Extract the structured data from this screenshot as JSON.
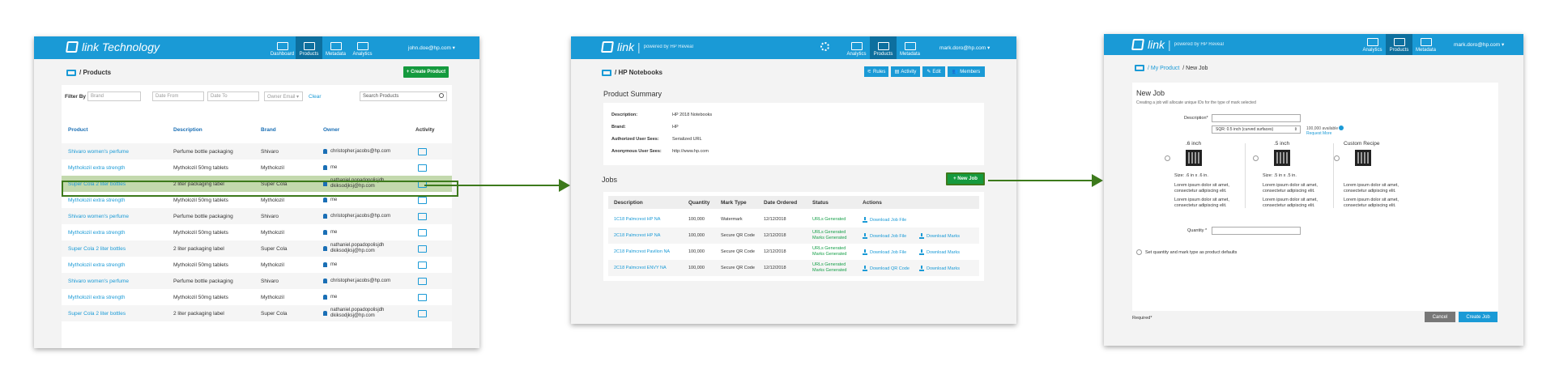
{
  "screen1": {
    "logo": "link Technology",
    "nav": [
      "Dashboard",
      "Products",
      "Metadata",
      "Analytics"
    ],
    "nav_active": 1,
    "user": "john.doe@hp.com ▾",
    "crumb": "/ Products",
    "create_btn": "Create Product",
    "filter_label": "Filter By",
    "filters": {
      "brand": "Brand",
      "date_from": "Date From",
      "date_to": "Date To",
      "owner": "Owner Email ▾",
      "clear": "Clear",
      "search": "Search Products"
    },
    "columns": [
      "Product",
      "Description",
      "Brand",
      "Owner",
      "Activity"
    ],
    "rows": [
      {
        "product": "Shivaro women's perfume",
        "description": "Perfume bottle packaging",
        "brand": "Shivaro",
        "owner": "christopher.jacobs@hp.com"
      },
      {
        "product": "Mytholozil extra strength",
        "description": "Mytholozil 50mg tablets",
        "brand": "Mytholozil",
        "owner": "me"
      },
      {
        "product": "Super Cola 2 liter bottles",
        "description": "2 liter packaging label",
        "brand": "Super Cola",
        "owner": "nathaniel.popadopolisjdh\ndkiksodjksj@hp.com",
        "highlight": true
      },
      {
        "product": "Mytholozil extra strength",
        "description": "Mytholozil 50mg tablets",
        "brand": "Mytholozil",
        "owner": "me"
      },
      {
        "product": "Shivaro women's perfume",
        "description": "Perfume bottle packaging",
        "brand": "Shivaro",
        "owner": "christopher.jacobs@hp.com"
      },
      {
        "product": "Mytholozil extra strength",
        "description": "Mytholozil 50mg tablets",
        "brand": "Mytholozil",
        "owner": "me"
      },
      {
        "product": "Super Cola 2 liter bottles",
        "description": "2 liter packaging label",
        "brand": "Super Cola",
        "owner": "nathaniel.popadopolisjdh\ndkiksodjksj@hp.com"
      },
      {
        "product": "Mytholozil extra strength",
        "description": "Mytholozil 50mg tablets",
        "brand": "Mytholozil",
        "owner": "me"
      },
      {
        "product": "Shivaro women's perfume",
        "description": "Perfume bottle packaging",
        "brand": "Shivaro",
        "owner": "christopher.jacobs@hp.com"
      },
      {
        "product": "Mytholozil extra strength",
        "description": "Mytholozil 50mg tablets",
        "brand": "Mytholozil",
        "owner": "me"
      },
      {
        "product": "Super Cola 2 liter bottles",
        "description": "2 liter packaging label",
        "brand": "Super Cola",
        "owner": "nathaniel.popadopolisjdh\ndkiksodjksj@hp.com"
      }
    ]
  },
  "screen2": {
    "logo": "link",
    "logo_sub": "powered by HP Reveal",
    "nav": [
      "Analytics",
      "Products",
      "Metadata"
    ],
    "nav_active": 1,
    "user": "mark.doro@hp.com ▾",
    "crumb": "/ HP Notebooks",
    "tabs": [
      "Rules",
      "Activity",
      "Edit",
      "Members"
    ],
    "summary_title": "Product Summary",
    "summary": [
      {
        "k": "Description:",
        "v": "HP 2018 Notebooks"
      },
      {
        "k": "Brand:",
        "v": "HP"
      },
      {
        "k": "Authorized User Sees:",
        "v": "Serialized URL"
      },
      {
        "k": "Anonymous User Sees:",
        "v": "http://www.hp.com"
      }
    ],
    "jobs_title": "Jobs",
    "new_job": "New Job",
    "columns": [
      "Description",
      "Quantity",
      "Mark Type",
      "Date Ordered",
      "Status",
      "Actions"
    ],
    "jobs": [
      {
        "desc": "1C18 Palmcrest HP NA",
        "qty": "100,000",
        "type": "Watermark",
        "date": "12/12/2018",
        "status": "URLs Generated",
        "a1": "Download Job File",
        "a2": ""
      },
      {
        "desc": "2C18 Palmcrest HP NA",
        "qty": "100,000",
        "type": "Secure QR Code",
        "date": "12/12/2018",
        "status": "URLs Generated\nMarks Generated",
        "a1": "Download Job File",
        "a2": "Download Marks"
      },
      {
        "desc": "2C18 Palmcrest Pavilion NA",
        "qty": "100,000",
        "type": "Secure QR Code",
        "date": "12/12/2018",
        "status": "URLs Generated\nMarks Generated",
        "a1": "Download Job File",
        "a2": "Download Marks"
      },
      {
        "desc": "2C18 Palmcrest ENVY NA",
        "qty": "100,000",
        "type": "Secure QR Code",
        "date": "12/12/2018",
        "status": "URLs Generated\nMarks Generated",
        "a1": "Download QR Code",
        "a2": "Download Marks"
      }
    ]
  },
  "screen3": {
    "logo": "link",
    "logo_sub": "powered by HP Reveal",
    "nav": [
      "Analytics",
      "Products",
      "Metadata"
    ],
    "nav_active": 1,
    "user": "mark.doro@hp.com ▾",
    "crumb_link": "/ My Product",
    "crumb_rest": "/ New Job",
    "title": "New Job",
    "subtitle": "Creating a job will allocate unique IDs for the type of mark selected",
    "desc_label": "Description*",
    "select_value": "SQR: 0.5 inch (curved surfaces)",
    "available": "100,000 available",
    "request_more": "Request More",
    "options": [
      {
        "title": ".6 inch",
        "size": "Size: .6 in x .6 in.",
        "l1": "Lorem ipsum dolor sit amet, consectetur adipiscing elit.",
        "l2": "Lorem ipsum dolor sit amet, consectetur adipiscing elit."
      },
      {
        "title": ".5 inch",
        "size": "Size: .5 in x .5 in.",
        "l1": "Lorem ipsum dolor sit amet, consectetur adipiscing elit.",
        "l2": "Lorem ipsum dolor sit amet, consectetur adipiscing elit."
      },
      {
        "title": "Custom Recipe",
        "size": "",
        "l1": "Lorem ipsum dolor sit amet, consectetur adipiscing elit.",
        "l2": "Lorem ipsum dolor sit amet, consectetur adipiscing elit."
      }
    ],
    "quantity_label": "Quantity *",
    "checkbox_label": "Set quantity and mark type as product defaults",
    "required": "Required*",
    "cancel": "Cancel",
    "create": "Create Job"
  },
  "colors": {
    "brand": "#1a9ad6",
    "green": "#159a3e",
    "arrow": "#3d7a1c",
    "highlight": "#c3d9ad"
  }
}
